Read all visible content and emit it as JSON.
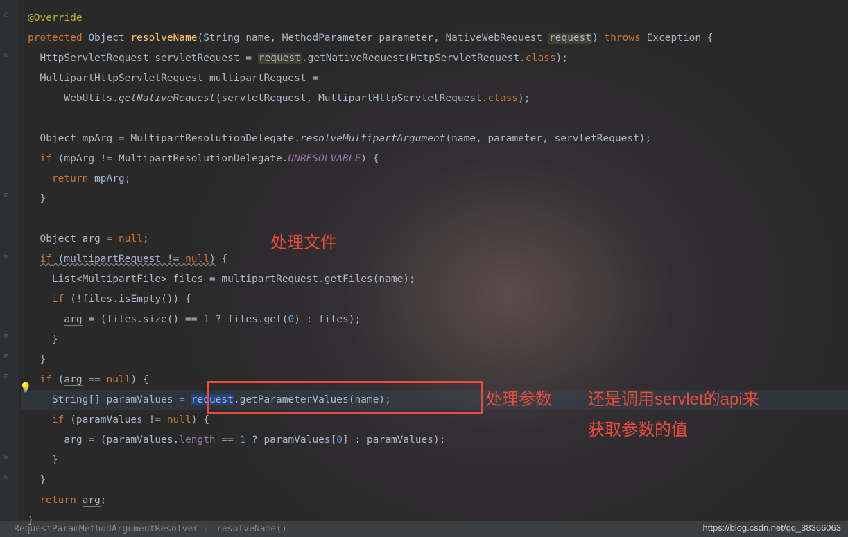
{
  "code": {
    "annotation": "@Override",
    "kw_protected": "protected",
    "kw_throws": "throws",
    "kw_if": "if",
    "kw_return": "return",
    "kw_null": "null",
    "kw_class": "class",
    "type_Object": "Object",
    "type_String": "String",
    "type_MethodParameter": "MethodParameter",
    "type_NativeWebRequest": "NativeWebRequest",
    "type_Exception": "Exception",
    "type_HttpServletRequest": "HttpServletRequest",
    "type_MultipartHttpServletRequest": "MultipartHttpServletRequest",
    "type_List": "List",
    "type_MultipartFile": "MultipartFile",
    "m_resolveName": "resolveName",
    "m_getNativeRequest": "getNativeRequest",
    "m_getNativeRequest2": "getNativeRequest",
    "m_resolveMultipartArgument": "resolveMultipartArgument",
    "m_getFiles": "getFiles",
    "m_isEmpty": "isEmpty",
    "m_size": "size",
    "m_get": "get",
    "m_getParameterValues": "getParameterValues",
    "c_WebUtils": "WebUtils",
    "c_MultipartResolutionDelegate": "MultipartResolutionDelegate",
    "f_UNRESOLVABLE": "UNRESOLVABLE",
    "f_length": "length",
    "p_name": "name",
    "p_parameter": "parameter",
    "p_request": "request",
    "v_servletRequest": "servletRequest",
    "v_multipartRequest": "multipartRequest",
    "v_mpArg": "mpArg",
    "v_arg": "arg",
    "v_files": "files",
    "v_paramValues": "paramValues",
    "num_1": "1",
    "num_0": "0"
  },
  "annotations": {
    "label1": "处理文件",
    "label2": "处理参数",
    "label3_line1": "还是调用servlet的api来",
    "label3_line2": "获取参数的值"
  },
  "breadcrumb": {
    "class": "RequestParamMethodArgumentResolver",
    "method": "resolveName()"
  },
  "watermark": "https://blog.csdn.net/qq_38366063"
}
